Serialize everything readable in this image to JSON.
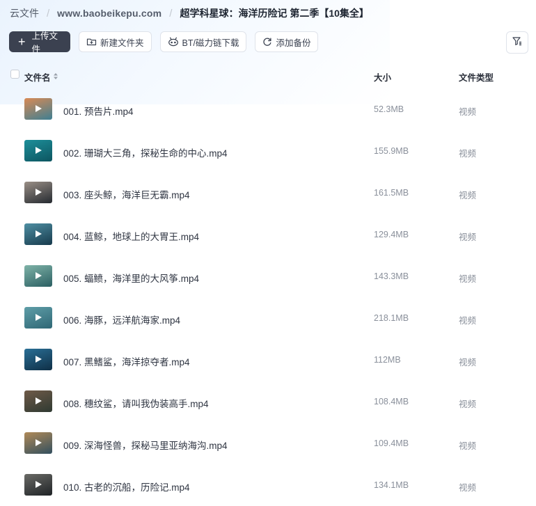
{
  "breadcrumb": {
    "root": "云文件",
    "site": "www.baobeikepu.com",
    "current": "超学科星球：海洋历险记 第二季【10集全】"
  },
  "toolbar": {
    "upload_label": "上传文件",
    "new_folder_label": "新建文件夹",
    "bt_label": "BT/磁力链下载",
    "backup_label": "添加备份"
  },
  "table": {
    "col_name": "文件名",
    "col_size": "大小",
    "col_type": "文件类型"
  },
  "files": [
    {
      "name": "001. 预告片.mp4",
      "size": "52.3MB",
      "type": "视频",
      "thumb_colors": [
        "#d98a55",
        "#3e7f92"
      ]
    },
    {
      "name": "002. 珊瑚大三角，探秘生命的中心.mp4",
      "size": "155.9MB",
      "type": "视频",
      "thumb_colors": [
        "#1d8f9a",
        "#0d5560"
      ]
    },
    {
      "name": "003. 座头鲸，海洋巨无霸.mp4",
      "size": "161.5MB",
      "type": "视频",
      "thumb_colors": [
        "#9a8f86",
        "#252a30"
      ]
    },
    {
      "name": "004. 蓝鲸，地球上的大胃王.mp4",
      "size": "129.4MB",
      "type": "视频",
      "thumb_colors": [
        "#4f8fa3",
        "#173a4c"
      ]
    },
    {
      "name": "005. 蝠鲼，海洋里的大风筝.mp4",
      "size": "143.3MB",
      "type": "视频",
      "thumb_colors": [
        "#7fb3a8",
        "#2b5f62"
      ]
    },
    {
      "name": "006. 海豚，远洋航海家.mp4",
      "size": "218.1MB",
      "type": "视频",
      "thumb_colors": [
        "#5f9ea8",
        "#2f6775"
      ]
    },
    {
      "name": "007. 黑鳍鲨，海洋掠夺者.mp4",
      "size": "112MB",
      "type": "视频",
      "thumb_colors": [
        "#2a6f96",
        "#0f2f46"
      ]
    },
    {
      "name": "008. 穗纹鲨，请叫我伪装高手.mp4",
      "size": "108.4MB",
      "type": "视频",
      "thumb_colors": [
        "#6f5a48",
        "#2f3a32"
      ]
    },
    {
      "name": "009. 深海怪兽，探秘马里亚纳海沟.mp4",
      "size": "109.4MB",
      "type": "视频",
      "thumb_colors": [
        "#b08a58",
        "#334f5e"
      ]
    },
    {
      "name": "010. 古老的沉船，历险记.mp4",
      "size": "134.1MB",
      "type": "视频",
      "thumb_colors": [
        "#6a6a66",
        "#1f2326"
      ]
    }
  ]
}
